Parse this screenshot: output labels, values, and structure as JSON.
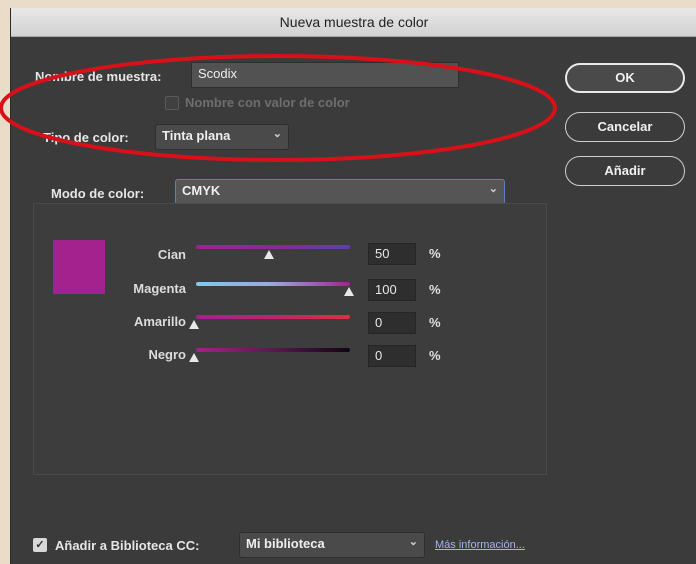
{
  "window": {
    "title": "Nueva muestra de color"
  },
  "form": {
    "name_label": "Nombre de muestra:",
    "name_value": "Scodix",
    "name_with_color_value_label": "Nombre con valor de color",
    "color_type_label": "Tipo de color:",
    "color_type_value": "Tinta plana",
    "color_mode_label": "Modo de color:",
    "color_mode_value": "CMYK"
  },
  "buttons": {
    "ok": "OK",
    "cancel": "Cancelar",
    "add": "Añadir"
  },
  "sliders": [
    {
      "label": "Cian",
      "value": "50",
      "unit": "%"
    },
    {
      "label": "Magenta",
      "value": "100",
      "unit": "%"
    },
    {
      "label": "Amarillo",
      "value": "0",
      "unit": "%"
    },
    {
      "label": "Negro",
      "value": "0",
      "unit": "%"
    }
  ],
  "swatch_color": "#a3228e",
  "annotation_color": "#d8101a",
  "footer": {
    "add_to_library_label": "Añadir a Biblioteca CC:",
    "add_to_library_checked": true,
    "library_value": "Mi biblioteca",
    "more_info_link": "Más información..."
  }
}
